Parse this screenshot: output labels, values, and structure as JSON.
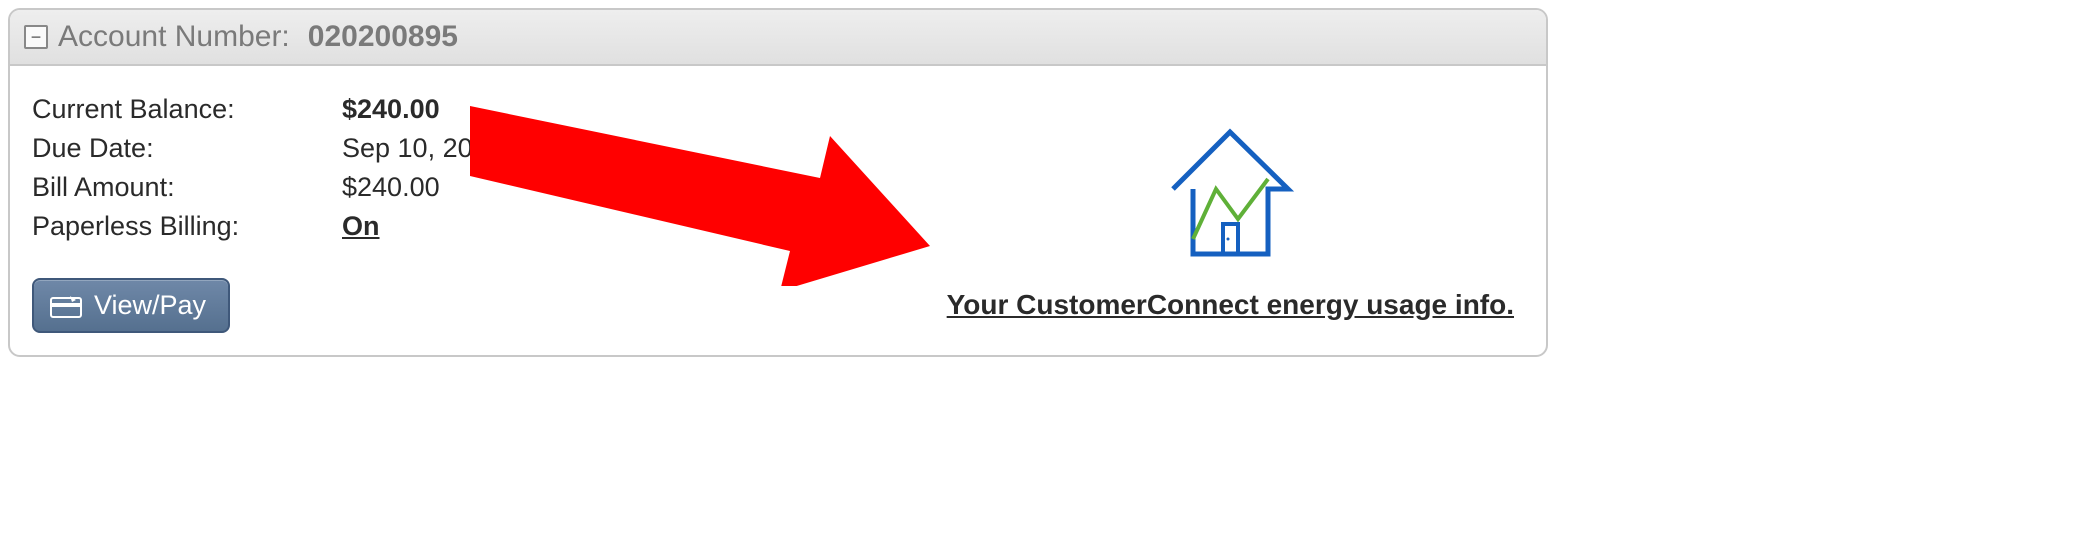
{
  "header": {
    "collapse_symbol": "−",
    "label": "Account Number:",
    "account_number": "020200895"
  },
  "billing": {
    "current_balance_label": "Current Balance:",
    "current_balance_value": "$240.00",
    "due_date_label": "Due Date:",
    "due_date_value": "Sep 10, 2021",
    "bill_amount_label": "Bill Amount:",
    "bill_amount_value": "$240.00",
    "paperless_label": "Paperless Billing:",
    "paperless_value": "On"
  },
  "buttons": {
    "view_pay": "View/Pay"
  },
  "links": {
    "energy_usage": "Your CustomerConnect energy usage info."
  },
  "icons": {
    "collapse": "minus-square-icon",
    "card": "credit-card-icon",
    "house": "house-up-arrow-icon",
    "arrow": "annotation-arrow-icon"
  },
  "colors": {
    "arrow": "#ff0000",
    "house_outline": "#1560c0",
    "house_graph": "#5fb038",
    "button_bg": "#5d789a"
  }
}
